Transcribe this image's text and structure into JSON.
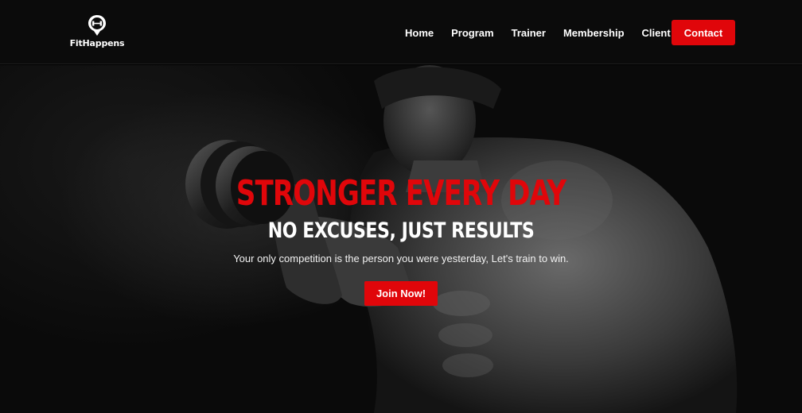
{
  "brand": {
    "name": "FitHappens",
    "icon": "dumbbell-pin-icon"
  },
  "nav": {
    "items": [
      {
        "label": "Home"
      },
      {
        "label": "Program"
      },
      {
        "label": "Trainer"
      },
      {
        "label": "Membership"
      },
      {
        "label": "Client"
      }
    ],
    "contact_label": "Contact"
  },
  "hero": {
    "headline": "STRONGER EVERY DAY",
    "subheadline": "NO EXCUSES, JUST RESULTS",
    "tagline": "Your only competition is the person you were yesterday, Let's train to win.",
    "cta_label": "Join Now!"
  },
  "colors": {
    "accent": "#e0060a",
    "header_bg": "#0b0b0b",
    "hero_bg": "#0a0a0a"
  }
}
